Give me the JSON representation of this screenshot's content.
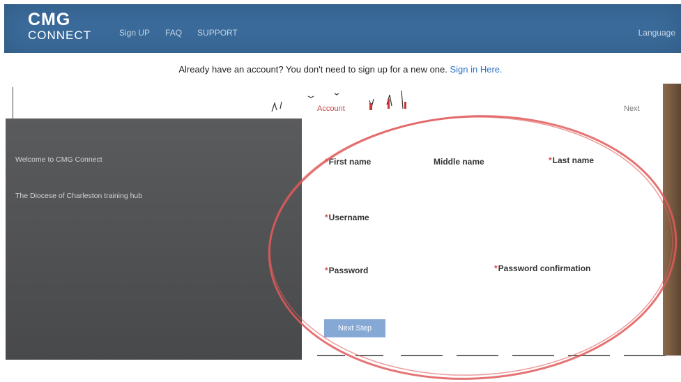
{
  "header": {
    "logo_line1": "CMG",
    "logo_line2": "CONNECT",
    "nav": [
      "Sign UP",
      "FAQ",
      "SUPPORT"
    ],
    "language": "Language"
  },
  "notice": {
    "text": "Already have an account? You don't need to sign up for a new one. ",
    "link": "Sign in Here."
  },
  "left_panel": {
    "welcome": "Welcome to CMG Connect",
    "line2": "The Diocese of Charleston training hub",
    "line3": "",
    "line4": "",
    "line5": ""
  },
  "tabs": {
    "account": "Account",
    "next": "Next"
  },
  "form": {
    "first_name": "First name",
    "middle_name": "Middle name",
    "last_name": "Last name",
    "username": "Username",
    "password": "Password",
    "password_confirmation": "Password confirmation",
    "submit": "Next Step"
  },
  "colors": {
    "header_bg": "#3a6a99",
    "link": "#2e73c6",
    "required": "#d64a4a",
    "active_tab": "#c44545",
    "annotation_circle": "#e05a5a",
    "button": "#7a9fd1"
  }
}
